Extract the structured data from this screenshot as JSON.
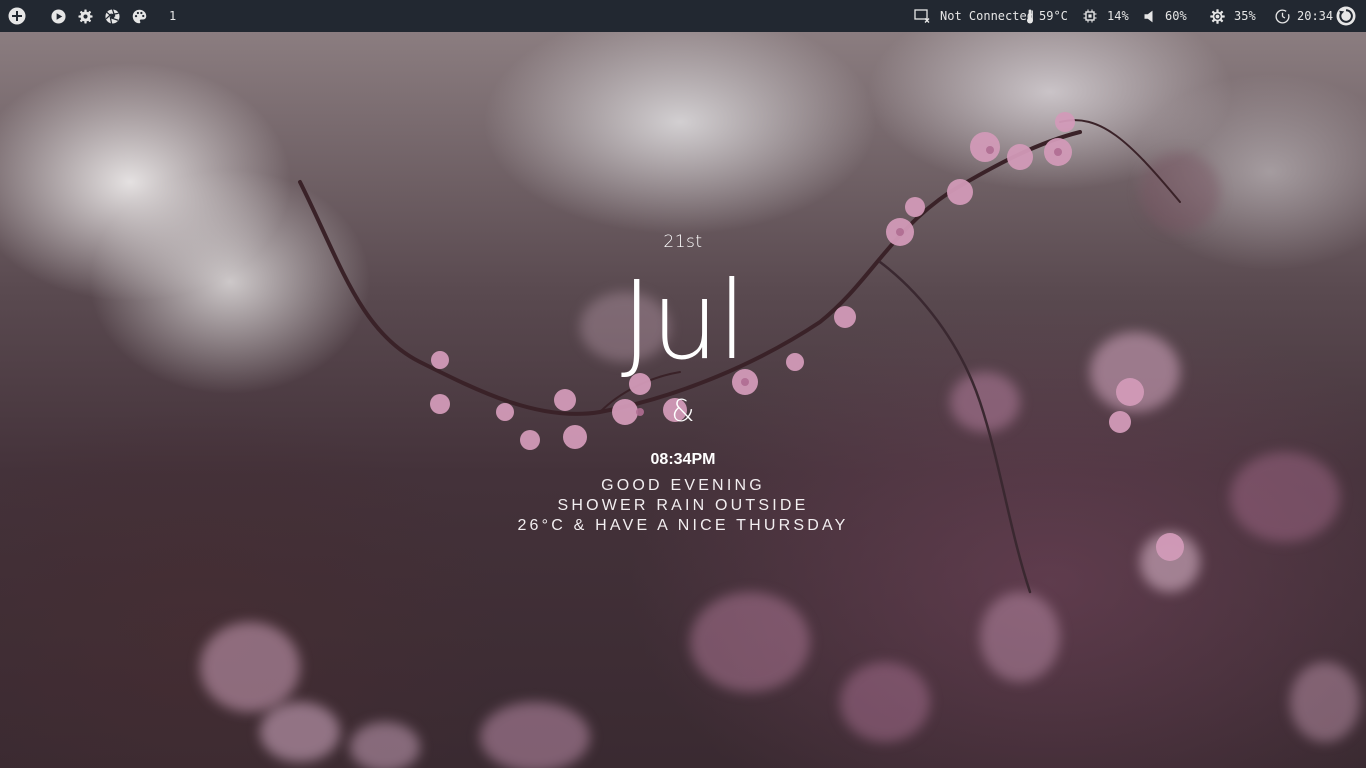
{
  "topbar": {
    "left_icons": [
      "add-circle-icon",
      "play-icon",
      "gear-icon",
      "aperture-icon",
      "palette-icon"
    ],
    "workspace": "1",
    "network": {
      "icon": "network-disconnected-icon",
      "label": "Not Connected"
    },
    "temperature": {
      "icon": "thermometer-icon",
      "label": "59°C"
    },
    "cpu": {
      "icon": "cpu-icon",
      "label": "14%"
    },
    "volume": {
      "icon": "speaker-icon",
      "label": "60%"
    },
    "brightness": {
      "icon": "brightness-icon",
      "label": "35%"
    },
    "clock": {
      "icon": "clock-icon",
      "label": "20:34"
    },
    "power_icon": "power-icon"
  },
  "widget": {
    "day": "21st",
    "month": "Jul",
    "ampersand": "&",
    "time": "08:34PM",
    "greeting": "GOOD EVENING",
    "weather": "SHOWER RAIN OUTSIDE",
    "temp_line": "26°C & HAVE A NICE THURSDAY"
  },
  "colors": {
    "bar_bg": "#222831",
    "bar_text": "#e6e6e6",
    "widget_text": "#ffffff",
    "blossom": "#c98fae"
  }
}
